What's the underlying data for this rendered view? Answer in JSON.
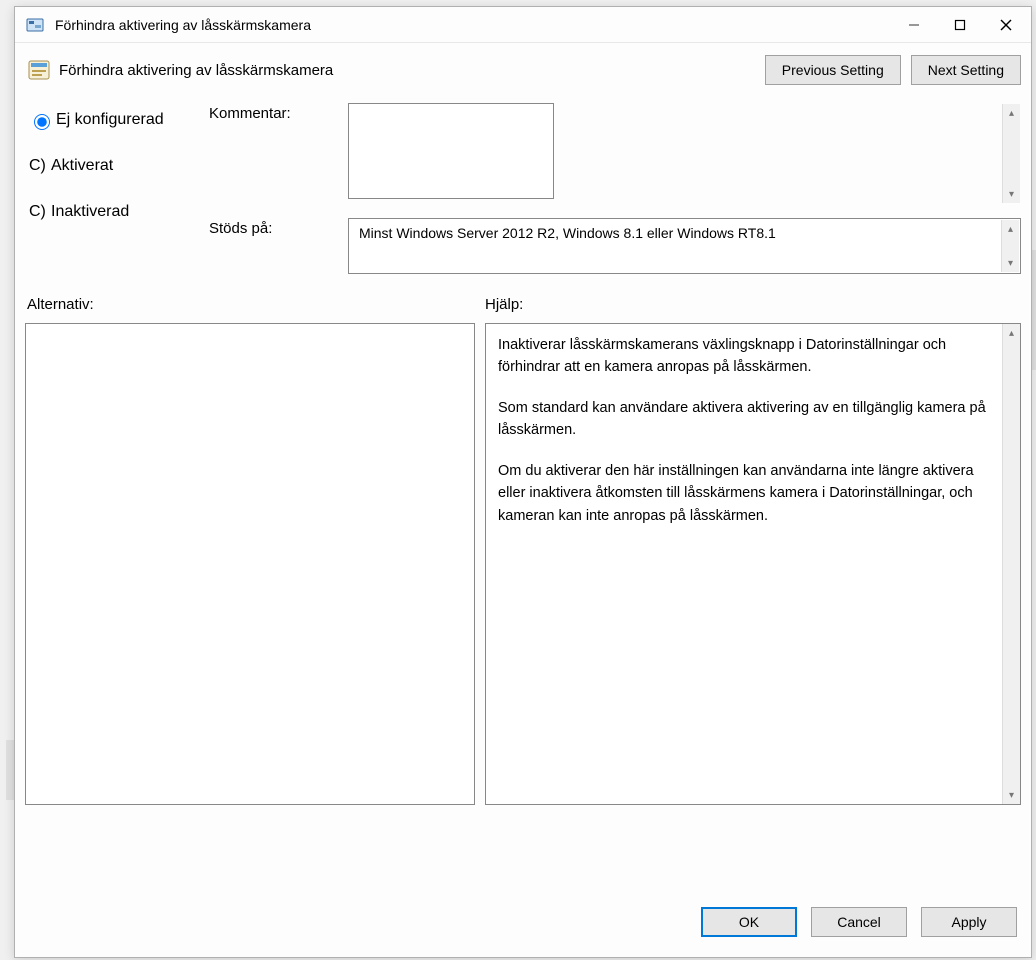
{
  "window": {
    "title": "Förhindra aktivering av låsskärmskamera"
  },
  "header": {
    "title": "Förhindra aktivering av låsskärmskamera",
    "prev": "Previous Setting",
    "next": "Next Setting"
  },
  "radios": {
    "not_configured": "Ej konfigurerad",
    "enabled": "Aktiverat",
    "disabled": "Inaktiverad",
    "selected": "not_configured"
  },
  "labels": {
    "comment": "Kommentar:",
    "supported": "Stöds på:",
    "options": "Alternativ:",
    "help": "Hjälp:"
  },
  "comment_value": "",
  "supported_value": "Minst Windows Server 2012 R2, Windows 8.1 eller Windows RT8.1",
  "help_paragraphs": [
    "Inaktiverar låsskärmskamerans växlingsknapp i Datorinställningar och förhindrar att en kamera anropas på låsskärmen.",
    "Som standard kan användare aktivera aktivering av en tillgänglig kamera på låsskärmen.",
    "Om du aktiverar den här inställningen kan användarna inte längre aktivera eller inaktivera åtkomsten till låsskärmens kamera i Datorinställningar, och kameran kan inte anropas på låsskärmen."
  ],
  "footer": {
    "ok": "OK",
    "cancel": "Cancel",
    "apply": "Apply"
  }
}
